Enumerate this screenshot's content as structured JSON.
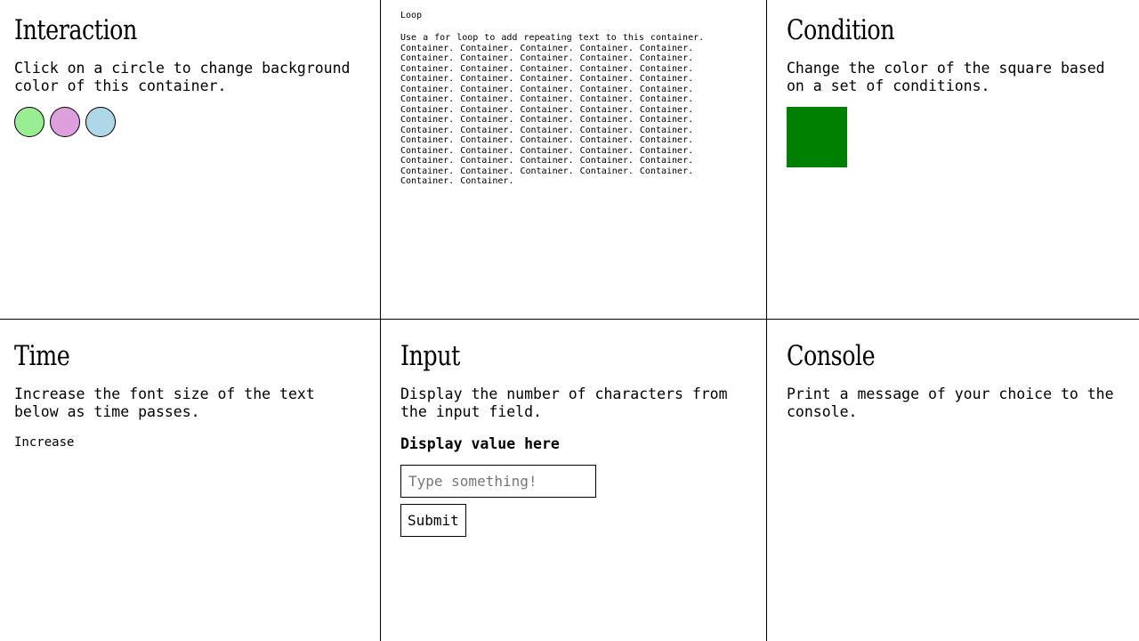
{
  "interaction": {
    "title": "Interaction",
    "description": "Click on a circle to change background color of this container.",
    "circles": [
      {
        "name": "green",
        "color": "#98ee90"
      },
      {
        "name": "plum",
        "color": "#dda0dd"
      },
      {
        "name": "lightblue",
        "color": "#add8e6"
      }
    ]
  },
  "loop": {
    "label": "Loop",
    "intro": "Use a for loop to add repeating text to this container.",
    "repeat_word": "Container.",
    "repeat_count": 67
  },
  "condition": {
    "title": "Condition",
    "description": "Change the color of the square based on a set of conditions.",
    "square_color": "#008000"
  },
  "time": {
    "title": "Time",
    "description": "Increase the font size of the text below as time passes.",
    "increase_text": "Increase"
  },
  "input": {
    "title": "Input",
    "description": "Display the number of characters from the input field.",
    "display_value": "Display value here",
    "placeholder": "Type something!",
    "value": "",
    "submit_label": "Submit"
  },
  "console": {
    "title": "Console",
    "description": "Print a message of your choice to the console."
  }
}
